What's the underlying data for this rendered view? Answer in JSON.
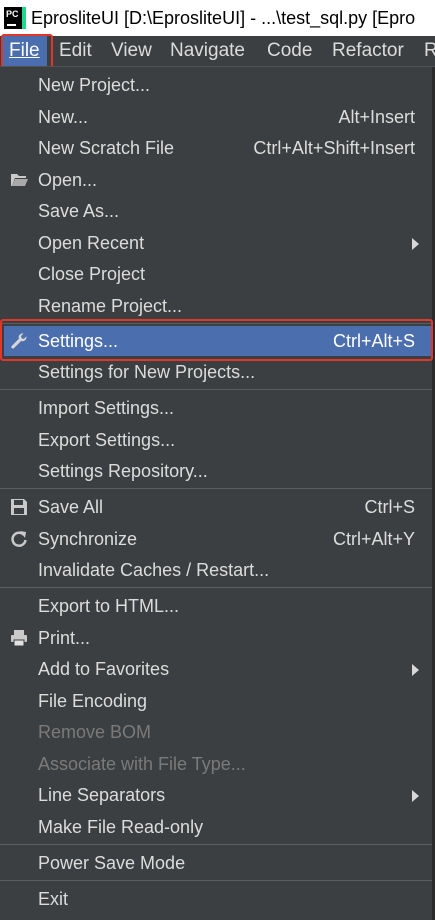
{
  "window": {
    "title": "EprosliteUI [D:\\EprosliteUI] - ...\\test_sql.py [Epro",
    "app_icon_text": "PC"
  },
  "menubar": {
    "file": "File",
    "edit": "Edit",
    "view": "View",
    "navigate": "Navigate",
    "code": "Code",
    "refactor": "Refactor",
    "more": "R"
  },
  "file_menu": {
    "new_project": "New Project...",
    "new": "New...",
    "new_shortcut": "Alt+Insert",
    "new_scratch": "New Scratch File",
    "new_scratch_shortcut": "Ctrl+Alt+Shift+Insert",
    "open": "Open...",
    "save_as": "Save As...",
    "open_recent": "Open Recent",
    "close_project": "Close Project",
    "rename_project": "Rename Project...",
    "settings": "Settings...",
    "settings_shortcut": "Ctrl+Alt+S",
    "settings_new_projects": "Settings for New Projects...",
    "import_settings": "Import Settings...",
    "export_settings": "Export Settings...",
    "settings_repository": "Settings Repository...",
    "save_all": "Save All",
    "save_all_shortcut": "Ctrl+S",
    "synchronize": "Synchronize",
    "synchronize_shortcut": "Ctrl+Alt+Y",
    "invalidate_caches": "Invalidate Caches / Restart...",
    "export_html": "Export to HTML...",
    "print": "Print...",
    "add_favorites": "Add to Favorites",
    "file_encoding": "File Encoding",
    "remove_bom": "Remove BOM",
    "associate_file_type": "Associate with File Type...",
    "line_separators": "Line Separators",
    "make_read_only": "Make File Read-only",
    "power_save": "Power Save Mode",
    "exit": "Exit"
  },
  "colors": {
    "menu_bg": "#3c3f41",
    "selection": "#4b6eaf",
    "highlight_box": "#e0362b",
    "disabled_text": "#7a7a7a"
  },
  "icons": {
    "app": "pycharm-icon",
    "open": "folder-icon",
    "settings": "wrench-icon",
    "save_all": "floppy-disk-icon",
    "synchronize": "refresh-icon",
    "print": "printer-icon",
    "submenu": "chevron-right-icon"
  }
}
